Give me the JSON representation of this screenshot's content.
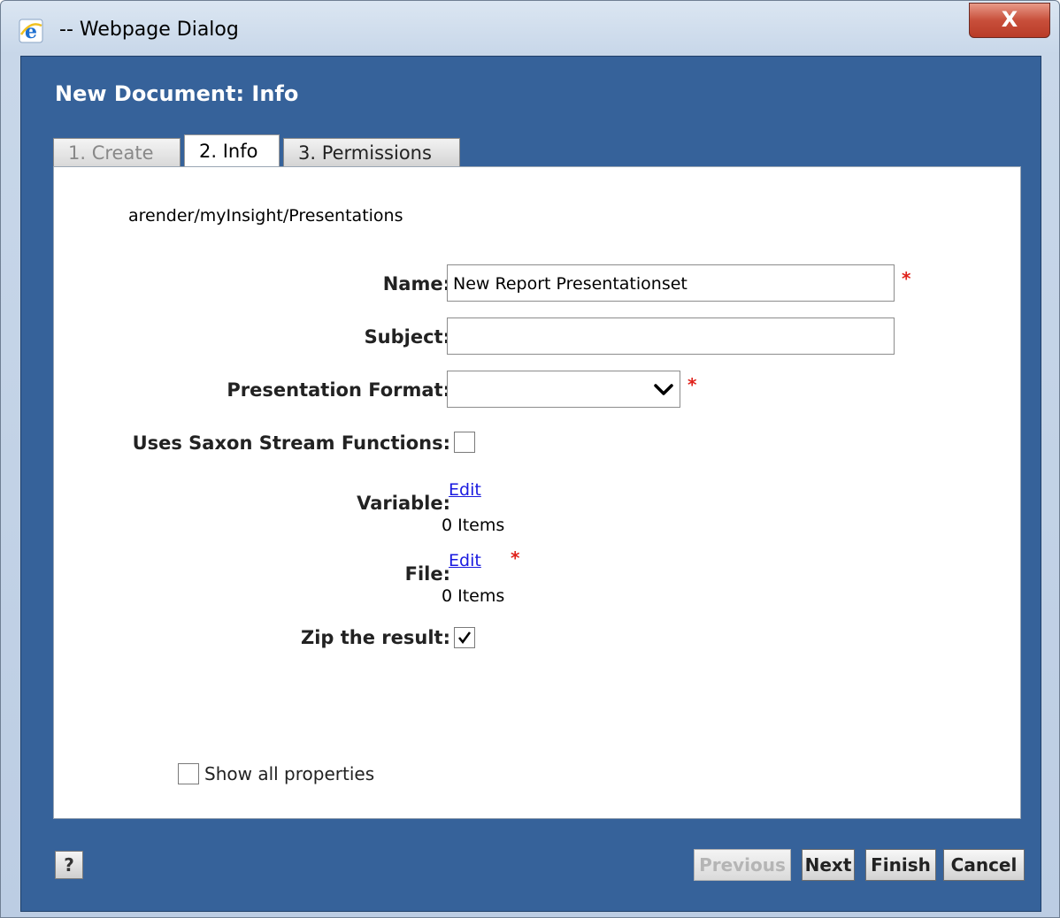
{
  "window": {
    "title": "-- Webpage Dialog",
    "close_label": "X"
  },
  "dialog": {
    "heading": "New Document: Info",
    "tabs": [
      {
        "label": "1. Create"
      },
      {
        "label": "2. Info"
      },
      {
        "label": "3. Permissions"
      }
    ],
    "path": "arender/myInsight/Presentations"
  },
  "form": {
    "name_label": "Name:",
    "name_value": "New Report Presentationset",
    "subject_label": "Subject:",
    "subject_value": "",
    "format_label": "Presentation Format:",
    "format_value": "",
    "saxon_label": "Uses Saxon Stream Functions:",
    "saxon_checked": false,
    "variable_label": "Variable:",
    "variable_edit": "Edit",
    "variable_items": "0 Items",
    "file_label": "File:",
    "file_edit": "Edit",
    "file_items": "0 Items",
    "zip_label": "Zip the result:",
    "zip_checked": true,
    "required_mark": "*",
    "show_all_label": "Show all properties",
    "show_all_checked": false
  },
  "footer": {
    "help_label": "?",
    "previous_label": "Previous",
    "next_label": "Next",
    "finish_label": "Finish",
    "cancel_label": "Cancel"
  },
  "colors": {
    "frame": "#36629a",
    "required": "#e0221b",
    "link": "#1a1ae0",
    "close_button": "#c84f3b"
  }
}
